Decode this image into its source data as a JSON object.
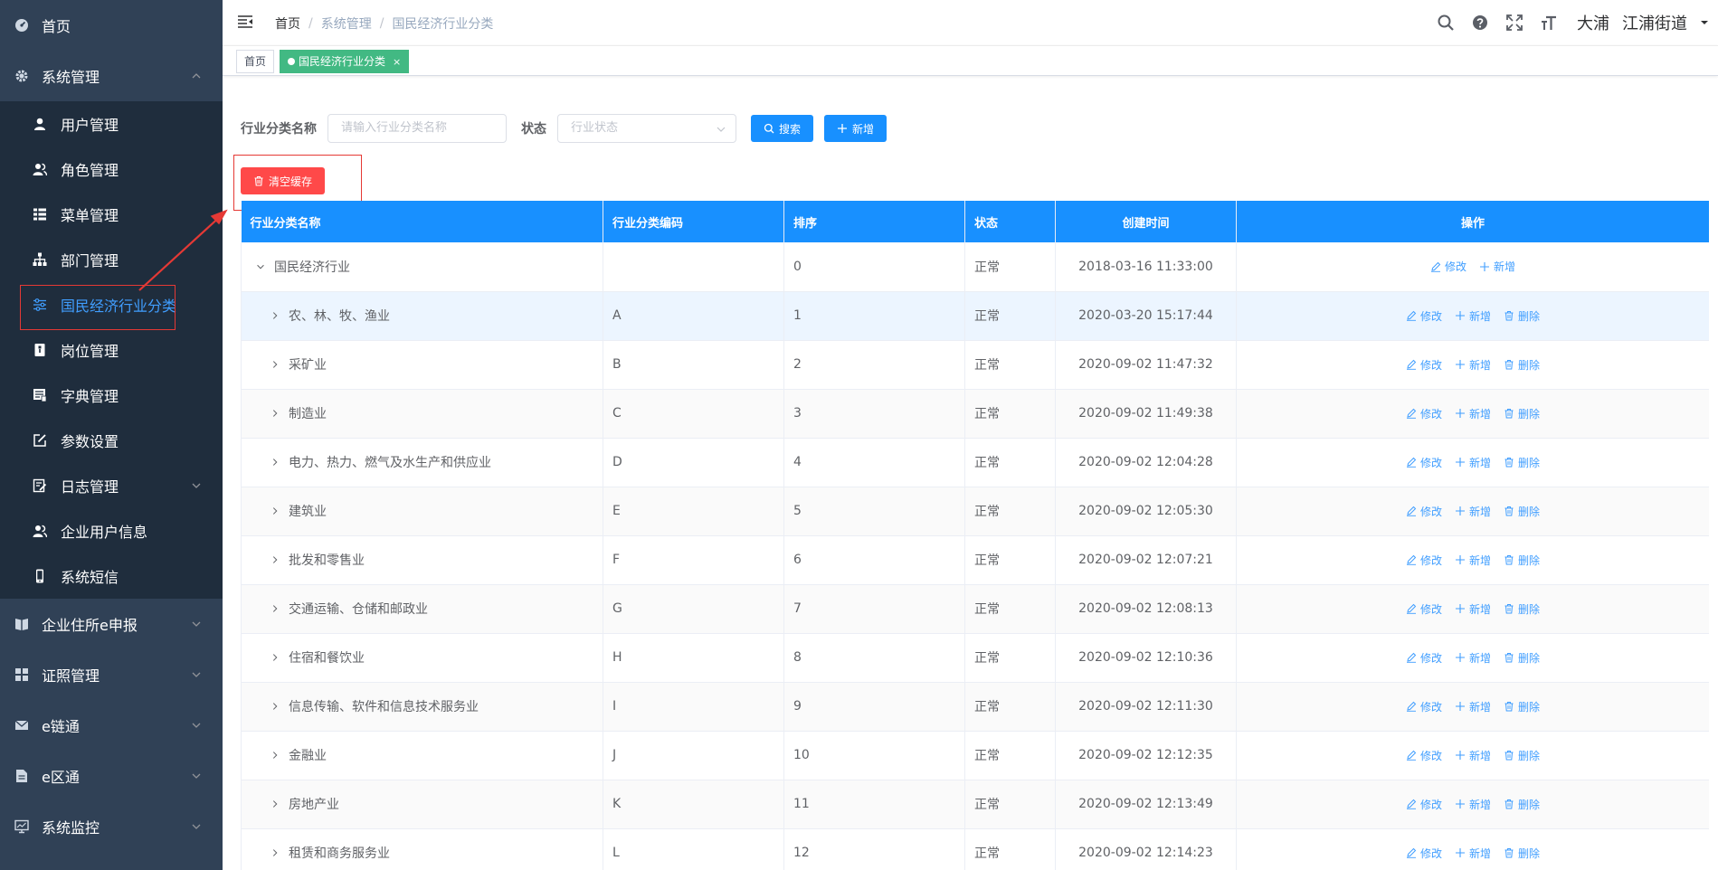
{
  "sidebar": {
    "home": "首页",
    "system": "系统管理",
    "sub": [
      {
        "label": "用户管理",
        "icon": "user-icon"
      },
      {
        "label": "角色管理",
        "icon": "peoples-icon"
      },
      {
        "label": "菜单管理",
        "icon": "tree-table-icon"
      },
      {
        "label": "部门管理",
        "icon": "tree-icon"
      },
      {
        "label": "国民经济行业分类",
        "icon": "sliders-icon"
      },
      {
        "label": "岗位管理",
        "icon": "post-icon"
      },
      {
        "label": "字典管理",
        "icon": "dict-icon"
      },
      {
        "label": "参数设置",
        "icon": "edit-icon"
      },
      {
        "label": "日志管理",
        "icon": "log-icon"
      },
      {
        "label": "企业用户信息",
        "icon": "peoples-icon"
      },
      {
        "label": "系统短信",
        "icon": "phone-icon"
      }
    ],
    "bottom": [
      {
        "label": "企业住所e申报",
        "icon": "book-icon"
      },
      {
        "label": "证照管理",
        "icon": "grid-icon"
      },
      {
        "label": "e链通",
        "icon": "mail-icon"
      },
      {
        "label": "e区通",
        "icon": "doc-icon"
      },
      {
        "label": "系统监控",
        "icon": "monitor-icon"
      }
    ]
  },
  "header": {
    "breadcrumb": [
      "首页",
      "系统管理",
      "国民经济行业分类"
    ],
    "user": [
      "大浦",
      "江浦街道"
    ]
  },
  "tags": {
    "home": "首页",
    "active": "国民经济行业分类",
    "close": "×"
  },
  "search": {
    "name_label": "行业分类名称",
    "name_placeholder": "请输入行业分类名称",
    "status_label": "状态",
    "status_placeholder": "行业状态",
    "search_btn": "搜索",
    "add_btn": "新增",
    "clear_btn": "清空缓存"
  },
  "table": {
    "headers": [
      "行业分类名称",
      "行业分类编码",
      "排序",
      "状态",
      "创建时间",
      "操作"
    ],
    "ops": {
      "edit": "修改",
      "add": "新增",
      "delete": "删除"
    },
    "rows": [
      {
        "name": "国民经济行业",
        "code": "",
        "sort": "0",
        "status": "正常",
        "time": "2018-03-16 11:33:00",
        "root": true
      },
      {
        "name": "农、林、牧、渔业",
        "code": "A",
        "sort": "1",
        "status": "正常",
        "time": "2020-03-20 15:17:44"
      },
      {
        "name": "采矿业",
        "code": "B",
        "sort": "2",
        "status": "正常",
        "time": "2020-09-02 11:47:32"
      },
      {
        "name": "制造业",
        "code": "C",
        "sort": "3",
        "status": "正常",
        "time": "2020-09-02 11:49:38"
      },
      {
        "name": "电力、热力、燃气及水生产和供应业",
        "code": "D",
        "sort": "4",
        "status": "正常",
        "time": "2020-09-02 12:04:28"
      },
      {
        "name": "建筑业",
        "code": "E",
        "sort": "5",
        "status": "正常",
        "time": "2020-09-02 12:05:30"
      },
      {
        "name": "批发和零售业",
        "code": "F",
        "sort": "6",
        "status": "正常",
        "time": "2020-09-02 12:07:21"
      },
      {
        "name": "交通运输、仓储和邮政业",
        "code": "G",
        "sort": "7",
        "status": "正常",
        "time": "2020-09-02 12:08:13"
      },
      {
        "name": "住宿和餐饮业",
        "code": "H",
        "sort": "8",
        "status": "正常",
        "time": "2020-09-02 12:10:36"
      },
      {
        "name": "信息传输、软件和信息技术服务业",
        "code": "I",
        "sort": "9",
        "status": "正常",
        "time": "2020-09-02 12:11:30"
      },
      {
        "name": "金融业",
        "code": "J",
        "sort": "10",
        "status": "正常",
        "time": "2020-09-02 12:12:35"
      },
      {
        "name": "房地产业",
        "code": "K",
        "sort": "11",
        "status": "正常",
        "time": "2020-09-02 12:13:49"
      },
      {
        "name": "租赁和商务服务业",
        "code": "L",
        "sort": "12",
        "status": "正常",
        "time": "2020-09-02 12:14:23"
      }
    ]
  },
  "colors": {
    "primary": "#1890ff",
    "danger": "#ff4949",
    "sidebar": "#304156",
    "tag_active": "#42b983"
  }
}
